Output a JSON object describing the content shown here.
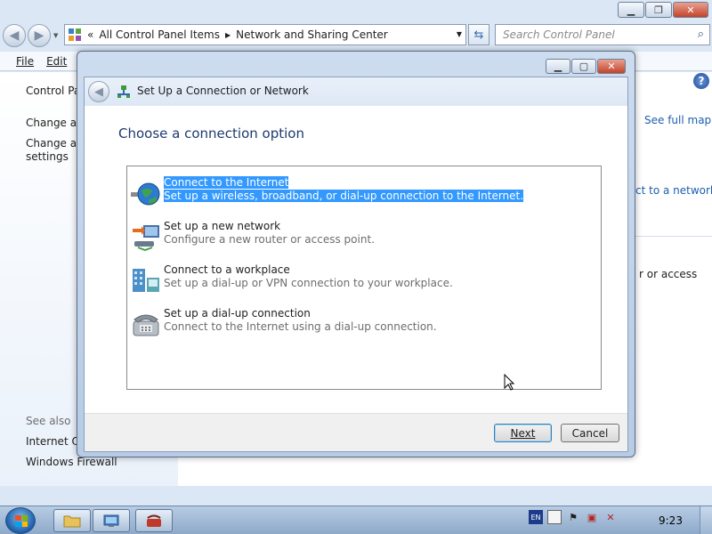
{
  "explorer": {
    "address_overflow": "«",
    "address_segments": [
      "All Control Panel Items",
      "Network and Sharing Center"
    ],
    "search_placeholder": "Search Control Panel",
    "menu": {
      "file": "File",
      "edit": "Edit"
    },
    "left_pane": {
      "control_panel": "Control Pa",
      "change_adapter": "Change ad",
      "change_advanced_1": "Change ad",
      "change_advanced_2": "settings",
      "see_also": "See also",
      "internet_options": "Internet Op",
      "windows_firewall": "Windows Firewall"
    },
    "right_pane": {
      "see_full_map": "See full map",
      "connect_to_network": "ct to a network",
      "or_access": "r or access"
    },
    "help": "?"
  },
  "dialog": {
    "title": "Set Up a Connection or Network",
    "heading": "Choose a connection option",
    "options": [
      {
        "title": "Connect to the Internet",
        "desc": "Set up a wireless, broadband, or dial-up connection to the Internet.",
        "icon": "globe-icon",
        "selected": true
      },
      {
        "title": "Set up a new network",
        "desc": "Configure a new router or access point.",
        "icon": "router-icon",
        "selected": false
      },
      {
        "title": "Connect to a workplace",
        "desc": "Set up a dial-up or VPN connection to your workplace.",
        "icon": "workplace-icon",
        "selected": false
      },
      {
        "title": "Set up a dial-up connection",
        "desc": "Connect to the Internet using a dial-up connection.",
        "icon": "phone-icon",
        "selected": false
      }
    ],
    "next_label": "Next",
    "cancel_label": "Cancel"
  },
  "taskbar": {
    "clock": "9:23"
  },
  "colors": {
    "selection": "#3399ff",
    "link": "#1e5eb0",
    "close_button": "#c3442a"
  }
}
